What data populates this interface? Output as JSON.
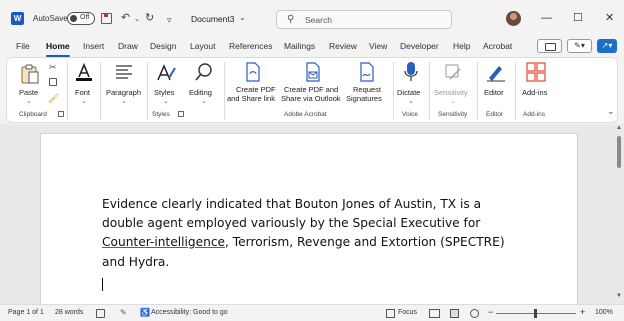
{
  "titlebar": {
    "autosave_label": "AutoSave",
    "autosave_state": "Off",
    "doc_title": "Document3",
    "title_chevron": "⌄",
    "search_placeholder": "Search",
    "minimize": "—",
    "maximize": "☐",
    "close": "✕",
    "undo": "↶",
    "redo": "↻",
    "undo_dropdown": "⌄",
    "qat_more": "▿"
  },
  "menu_tabs": [
    "File",
    "Home",
    "Insert",
    "Draw",
    "Design",
    "Layout",
    "References",
    "Mailings",
    "Review",
    "View",
    "Developer",
    "Help",
    "Acrobat"
  ],
  "active_tab": "Home",
  "ribbon": {
    "clipboard": {
      "paste": "Paste",
      "group": "Clipboard"
    },
    "font": {
      "label": "Font"
    },
    "paragraph": {
      "label": "Paragraph"
    },
    "styles": {
      "label": "Styles",
      "group": "Styles"
    },
    "editing": {
      "label": "Editing"
    },
    "acrobat": {
      "create_share_l1": "Create PDF",
      "create_share_l2": "and Share link",
      "create_outlook_l1": "Create PDF and",
      "create_outlook_l2": "Share via Outlook",
      "request_l1": "Request",
      "request_l2": "Signatures",
      "group": "Adobe Acrobat"
    },
    "voice": {
      "dictate": "Dictate",
      "group": "Voice"
    },
    "sensitivity": {
      "label": "Sensitivity",
      "group": "Sensitivity"
    },
    "editor": {
      "label": "Editor",
      "group": "Editor"
    },
    "addins": {
      "label": "Add-ins",
      "group": "Add-ins"
    }
  },
  "document": {
    "text_before": "Evidence clearly indicated that Bouton Jones of Austin, TX is a double agent employed variously by the Special Executive for ",
    "text_flagged": "Counter-intelligence",
    "text_after": ", Terrorism, Revenge and Extortion (SPECTRE) and Hydra."
  },
  "statusbar": {
    "page": "Page 1 of 1",
    "words": "28 words",
    "accessibility": "Accessibility: Good to go",
    "focus": "Focus",
    "zoom": "100%",
    "zoom_minus": "−",
    "zoom_plus": "+"
  },
  "colors": {
    "brand": "#185abd",
    "share": "#1a6fc9",
    "acrobat_icon": "#2b5fbf",
    "addins": "#e5533d",
    "save": "#b0306a"
  },
  "icons": {
    "search": "search-icon",
    "paste": "clipboard-icon",
    "font": "font-color-icon",
    "paragraph": "paragraph-icon",
    "styles": "styles-icon",
    "editing": "magnifier-icon",
    "dictate": "microphone-icon",
    "editor": "pen-icon",
    "addins": "grid-icon"
  }
}
